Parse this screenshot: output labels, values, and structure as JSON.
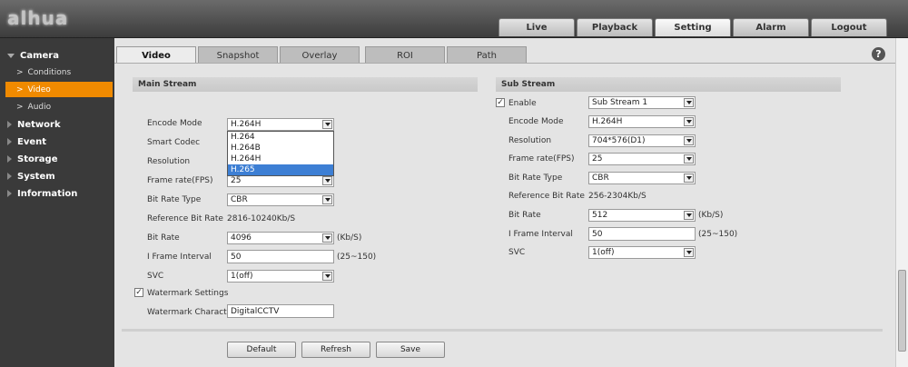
{
  "logo": "alhua",
  "top_tabs": [
    {
      "label": "Live"
    },
    {
      "label": "Playback"
    },
    {
      "label": "Setting"
    },
    {
      "label": "Alarm"
    },
    {
      "label": "Logout"
    }
  ],
  "nav": {
    "camera": "Camera",
    "conditions": "Conditions",
    "video": "Video",
    "audio": "Audio",
    "network": "Network",
    "event": "Event",
    "storage": "Storage",
    "system": "System",
    "information": "Information"
  },
  "sub_tabs": [
    {
      "label": "Video"
    },
    {
      "label": "Snapshot"
    },
    {
      "label": "Overlay"
    },
    {
      "label": "ROI"
    },
    {
      "label": "Path"
    }
  ],
  "help": "?",
  "main_stream": {
    "title": "Main Stream",
    "encode_mode_label": "Encode Mode",
    "encode_mode_value": "H.264H",
    "smart_codec_label": "Smart Codec",
    "resolution_label": "Resolution",
    "frame_rate_label": "Frame rate(FPS)",
    "frame_rate_value": "25",
    "bit_rate_type_label": "Bit Rate Type",
    "bit_rate_type_value": "CBR",
    "ref_bit_rate_label": "Reference Bit Rate",
    "ref_bit_rate_value": "2816-10240Kb/S",
    "bit_rate_label": "Bit Rate",
    "bit_rate_value": "4096",
    "bit_rate_unit": "(Kb/S)",
    "iframe_label": "I Frame Interval",
    "iframe_value": "50",
    "iframe_range": "(25~150)",
    "svc_label": "SVC",
    "svc_value": "1(off)",
    "watermark_label": "Watermark Settings",
    "watermark_char_label": "Watermark Character",
    "watermark_char_value": "DigitalCCTV"
  },
  "encode_dropdown": [
    "H.264",
    "H.264B",
    "H.264H",
    "H.265"
  ],
  "sub_stream": {
    "title": "Sub Stream",
    "enable_label": "Enable",
    "stream_value": "Sub Stream 1",
    "encode_mode_label": "Encode Mode",
    "encode_mode_value": "H.264H",
    "resolution_label": "Resolution",
    "resolution_value": "704*576(D1)",
    "frame_rate_label": "Frame rate(FPS)",
    "frame_rate_value": "25",
    "bit_rate_type_label": "Bit Rate Type",
    "bit_rate_type_value": "CBR",
    "ref_bit_rate_label": "Reference Bit Rate",
    "ref_bit_rate_value": "256-2304Kb/S",
    "bit_rate_label": "Bit Rate",
    "bit_rate_value": "512",
    "bit_rate_unit": "(Kb/S)",
    "iframe_label": "I Frame Interval",
    "iframe_value": "50",
    "iframe_range": "(25~150)",
    "svc_label": "SVC",
    "svc_value": "1(off)"
  },
  "buttons": {
    "default": "Default",
    "refresh": "Refresh",
    "save": "Save"
  },
  "check_mark": "✓"
}
